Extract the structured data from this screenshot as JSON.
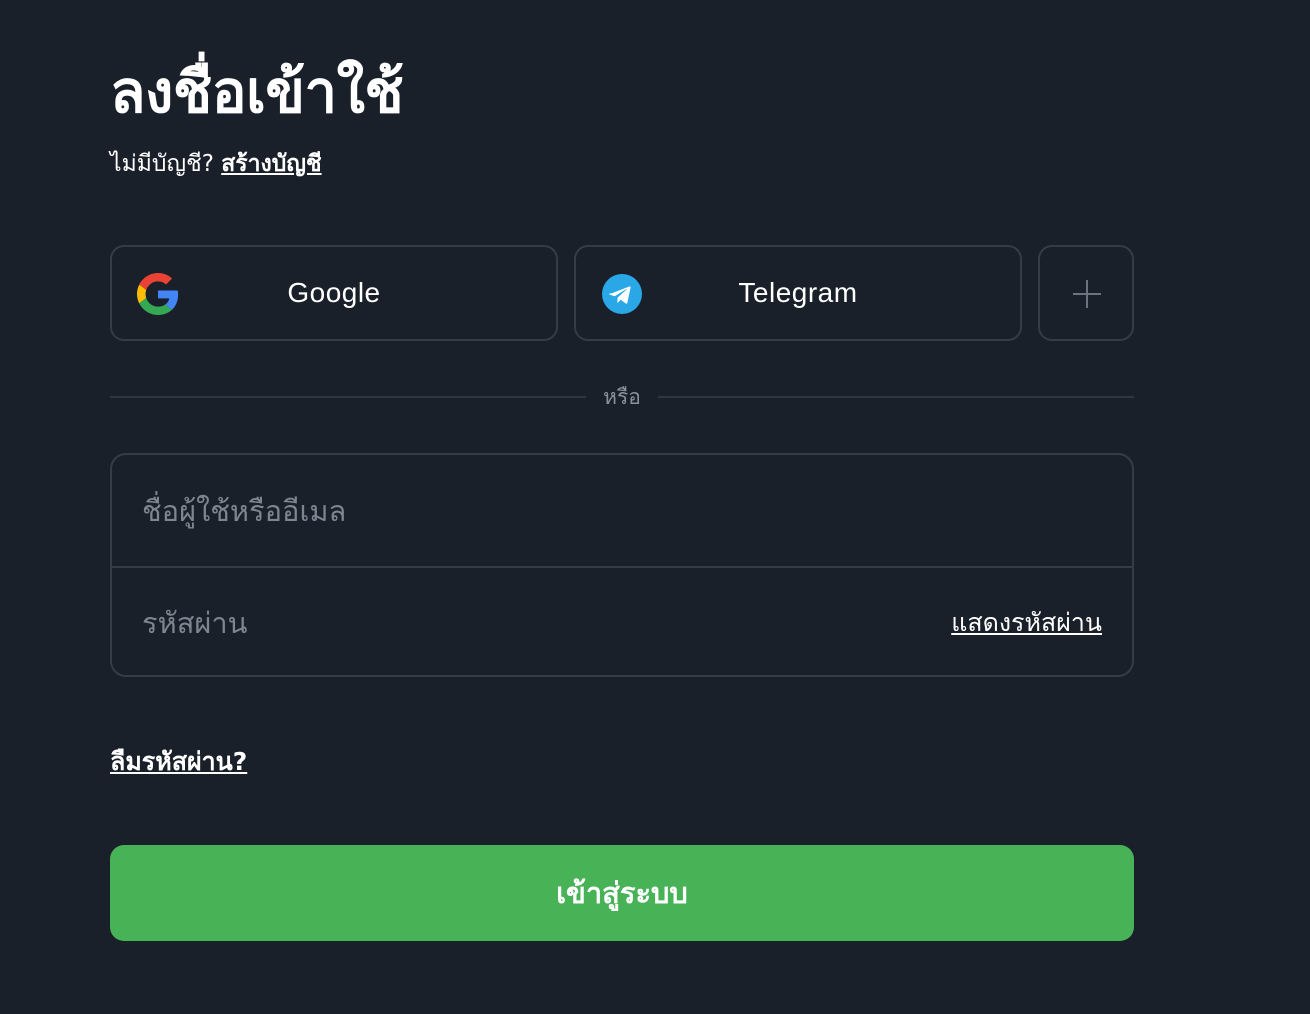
{
  "header": {
    "title": "ลงชื่อเข้าใช้",
    "no_account_text": "ไม่มีบัญชี?",
    "create_account_link": "สร้างบัญชี"
  },
  "social_login": {
    "google": {
      "label": "Google",
      "icon": "google-icon"
    },
    "telegram": {
      "label": "Telegram",
      "icon": "telegram-icon",
      "color": "#2aa7e6"
    },
    "more": {
      "icon": "plus-icon"
    }
  },
  "divider": {
    "text": "หรือ"
  },
  "form": {
    "username": {
      "placeholder": "ชื่อผู้ใช้หรืออีเมล",
      "value": ""
    },
    "password": {
      "placeholder": "รหัสผ่าน",
      "value": ""
    },
    "show_password_link": "แสดงรหัสผ่าน",
    "forgot_password_link": "ลืมรหัสผ่าน?",
    "submit_label": "เข้าสู่ระบบ"
  },
  "colors": {
    "background": "#1a202a",
    "border": "#343c48",
    "primary_button": "#48b257",
    "muted_text": "#7d8590"
  }
}
